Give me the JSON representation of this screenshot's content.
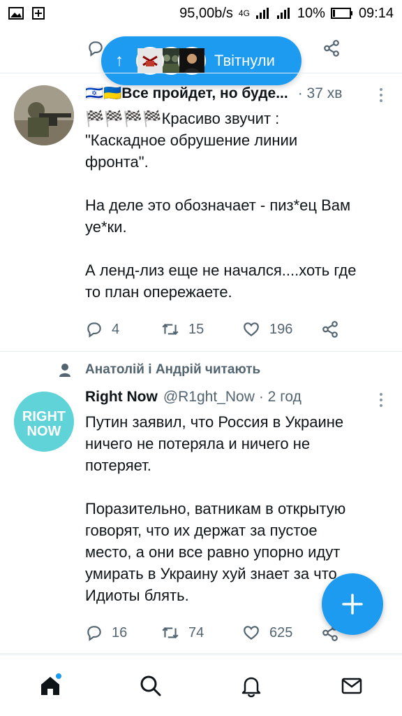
{
  "status_bar": {
    "speed": "95,00b/s",
    "network": "4G",
    "battery": "10%",
    "time": "09:14"
  },
  "pill": {
    "label": "Твітнули"
  },
  "tweets": [
    {
      "name": "🇮🇱🇺🇦Все пройдет, но буде...",
      "time": "· 37 хв",
      "body": "🏁🏁🏁🏁Красиво звучит :\n\"Каскадное обрушение линии\nфронта\".\n\nНа деле это обозначает - пиз*ец Вам\nуе*ки.\n\nА ленд-лиз еще не начался....хоть где\nто план опережаете.",
      "replies": "4",
      "retweets": "15",
      "likes": "196"
    },
    {
      "social_context": "Анатолій і Андрій читають",
      "name": "Right Now",
      "handle": "@R1ght_Now",
      "time": "· 2 год",
      "avatar_text": "RIGHT NOW",
      "body": "Путин заявил, что Россия в Украине\nничего не потеряла и ничего не\nпотеряет.\n\nПоразительно, ватникам в открытую\nговорят, что их держат за пустое\nместо, а они все равно упорно идут\nумирать в Украину хуй знает за что.\nИдиоты блять.",
      "replies": "16",
      "retweets": "74",
      "likes": "625"
    }
  ],
  "colors": {
    "accent": "#1d9bf0",
    "secondary_text": "#536471",
    "right_now_avatar": "#5fd3d8"
  },
  "icons": {
    "reply": "reply-icon",
    "retweet": "retweet-icon",
    "like": "like-icon",
    "share": "share-icon",
    "home": "home-icon",
    "search": "search-icon",
    "notifications": "bell-icon",
    "messages": "mail-icon",
    "compose": "compose-plus-icon"
  }
}
